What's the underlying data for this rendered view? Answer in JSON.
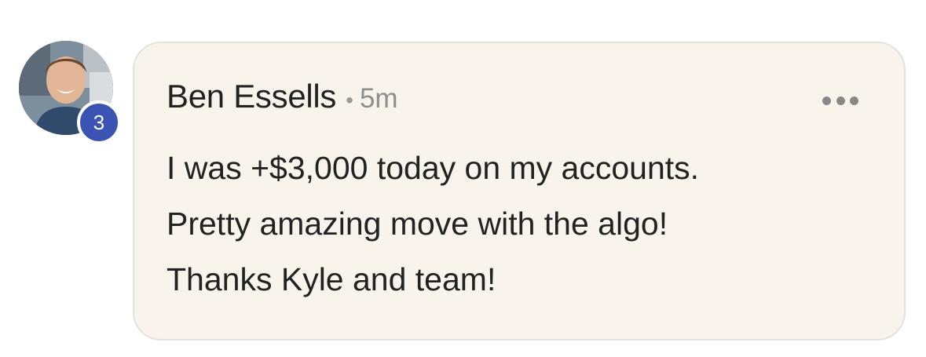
{
  "comment": {
    "author": "Ben Essells",
    "separator": "•",
    "time": "5m",
    "badge_count": "3",
    "lines": [
      "I was +$3,000 today on my accounts.",
      "Pretty amazing move with the algo!",
      "Thanks Kyle and team!"
    ]
  },
  "icons": {
    "more": "more-horizontal-icon",
    "avatar": "user-avatar"
  },
  "colors": {
    "bubble_bg": "#f8f4eb",
    "bubble_border": "#e4e2dd",
    "badge_bg": "#3b54b4",
    "text": "#222222",
    "muted": "#8e8e8e"
  }
}
